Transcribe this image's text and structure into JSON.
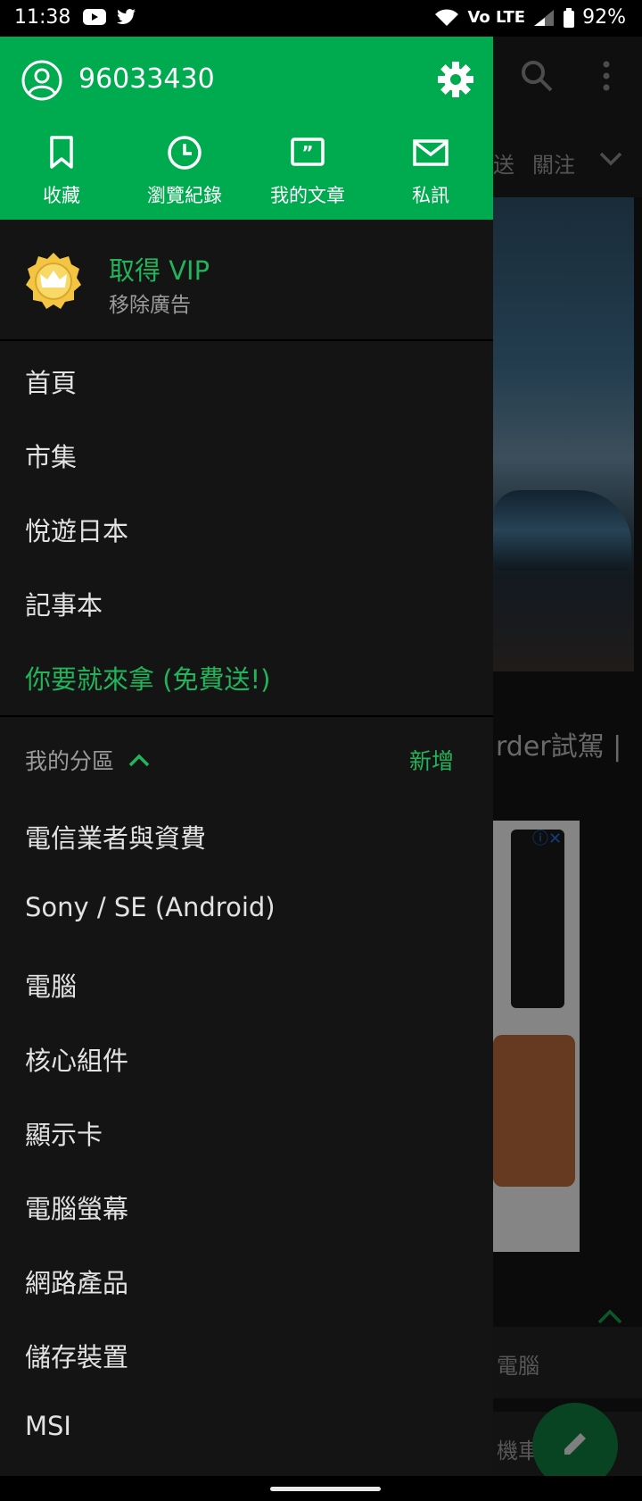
{
  "status_bar": {
    "time": "11:38",
    "network": "Vo LTE",
    "battery": "92%",
    "left_icons": [
      "youtube-icon",
      "twitter-icon"
    ],
    "right_icons": [
      "wifi-icon",
      "volte-icon",
      "signal-icon",
      "battery-icon"
    ]
  },
  "drawer": {
    "username": "96033430",
    "accent_color": "#00ab4f",
    "quick_actions": [
      {
        "label": "收藏",
        "icon": "bookmark-icon"
      },
      {
        "label": "瀏覽紀錄",
        "icon": "history-icon"
      },
      {
        "label": "我的文章",
        "icon": "my-articles-icon"
      },
      {
        "label": "私訊",
        "icon": "mail-icon"
      }
    ],
    "vip": {
      "title": "取得 VIP",
      "subtitle": "移除廣告",
      "icon": "crown-badge-icon"
    },
    "main_menu": [
      "首頁",
      "市集",
      "悅遊日本",
      "記事本"
    ],
    "promo": "你要就來拿 (免費送!)",
    "section": {
      "label": "我的分區",
      "add_label": "新增"
    },
    "forums": [
      "電信業者與資費",
      "Sony / SE (Android)",
      "電腦",
      "核心組件",
      "顯示卡",
      "電腦螢幕",
      "網路產品",
      "儲存裝置",
      "MSI"
    ]
  },
  "background_app": {
    "tabs": [
      "送",
      "關注"
    ],
    "article_title": "rder試駕 |",
    "category_cells": [
      "電腦",
      "機車"
    ]
  }
}
